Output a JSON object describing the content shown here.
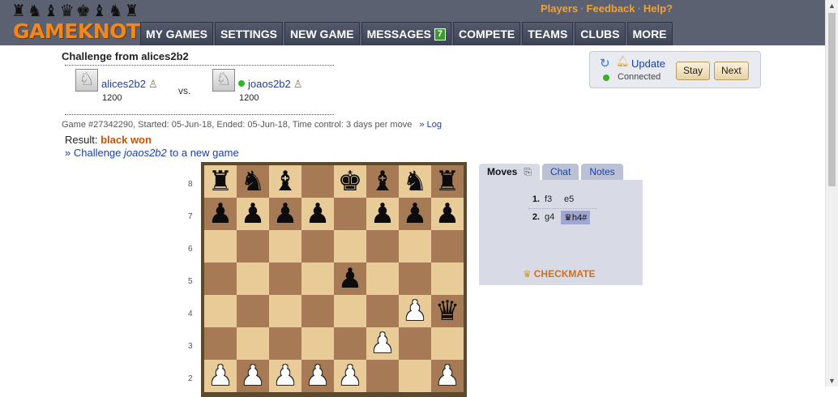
{
  "header": {
    "logo_pieces": "♜♞♝♛♚♝♞♜",
    "logo_text": "GAMEKNOT",
    "top_links": [
      "Players",
      "Feedback",
      "Help?"
    ],
    "nav": [
      {
        "label": "MY GAMES"
      },
      {
        "label": "SETTINGS"
      },
      {
        "label": "NEW GAME"
      },
      {
        "label": "MESSAGES",
        "badge": "7"
      },
      {
        "label": "COMPETE"
      },
      {
        "label": "TEAMS"
      },
      {
        "label": "CLUBS"
      },
      {
        "label": "MORE"
      }
    ]
  },
  "challenge": {
    "title": "Challenge from alices2b2",
    "vs": "vs.",
    "player1": {
      "name": "alices2b2",
      "rating": "1200",
      "avatar_icon": "knight-icon",
      "pawn_icon": "pawn-icon"
    },
    "player2": {
      "name": "joaos2b2",
      "rating": "1200",
      "online": true,
      "avatar_icon": "knight-icon",
      "pawn_icon": "pawn-icon"
    },
    "game_info": "Game #27342290, Started: 05-Jun-18, Ended: 05-Jun-18, Time control: 3 days per move",
    "log_link": "» Log",
    "result_label": "Result:",
    "result_value": "black won",
    "challenge_prefix": "» Challenge ",
    "challenge_user": "joaos2b2",
    "challenge_suffix": " to a new game"
  },
  "status": {
    "update_label": "Update",
    "connection": "Connected",
    "stay_label": "Stay",
    "next_label": "Next"
  },
  "board": {
    "ranks": [
      "8",
      "7",
      "6",
      "5",
      "4",
      "3",
      "2"
    ],
    "rows": [
      [
        "bR",
        "bN",
        "bB",
        "",
        "bK",
        "bB",
        "bN",
        "bR"
      ],
      [
        "bP",
        "bP",
        "bP",
        "bP",
        "",
        "bP",
        "bP",
        "bP"
      ],
      [
        "",
        "",
        "",
        "",
        "",
        "",
        "",
        ""
      ],
      [
        "",
        "",
        "",
        "",
        "bP",
        "",
        "",
        ""
      ],
      [
        "",
        "",
        "",
        "",
        "",
        "",
        "wP",
        "bQ"
      ],
      [
        "",
        "",
        "",
        "",
        "",
        "wP",
        "",
        ""
      ],
      [
        "wP",
        "wP",
        "wP",
        "wP",
        "wP",
        "",
        "",
        "wP"
      ]
    ]
  },
  "panel": {
    "tabs": [
      "Moves",
      "Chat",
      "Notes"
    ],
    "moves": [
      {
        "num": "1.",
        "white": "f3",
        "black": "e5"
      },
      {
        "num": "2.",
        "white": "g4",
        "black": "h4#",
        "black_icon": "queen-icon"
      }
    ],
    "result_text": "CHECKMATE"
  }
}
